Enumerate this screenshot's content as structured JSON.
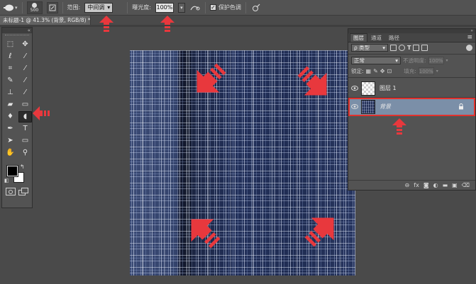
{
  "options_bar": {
    "tool_icon": "dodge-tool-icon",
    "brush_size": "500",
    "range_label": "范围:",
    "range_value": "中间调",
    "exposure_label": "曝光度:",
    "exposure_value": "100%",
    "airbrush_icon": "airbrush-icon",
    "protect_tones_label": "保护色调",
    "protect_tones_checked": true,
    "pressure_icon": "pressure-size-icon"
  },
  "document_tab": {
    "title": "未标题-1 @ 41.3% (背景, RGB/8) *",
    "close": "×"
  },
  "tools_panel": {
    "collapse": "«",
    "tools": [
      {
        "id": "rect-marquee",
        "icon": "rect-marquee-icon",
        "glyph": "⬚",
        "active": false
      },
      {
        "id": "move",
        "icon": "move-icon",
        "glyph": "✥",
        "active": false
      },
      {
        "id": "lasso",
        "icon": "lasso-icon",
        "glyph": "ℓ",
        "active": false
      },
      {
        "id": "magic-wand",
        "icon": "magic-wand-icon",
        "glyph": "⁄",
        "active": false
      },
      {
        "id": "crop",
        "icon": "crop-icon",
        "glyph": "⌗",
        "active": false
      },
      {
        "id": "eyedropper",
        "icon": "eyedropper-icon",
        "glyph": "⁄",
        "active": false
      },
      {
        "id": "healing-brush",
        "icon": "healing-brush-icon",
        "glyph": "✎",
        "active": false
      },
      {
        "id": "brush",
        "icon": "brush-icon",
        "glyph": "⁄",
        "active": false
      },
      {
        "id": "clone-stamp",
        "icon": "clone-stamp-icon",
        "glyph": "⊥",
        "active": false
      },
      {
        "id": "history-brush",
        "icon": "history-brush-icon",
        "glyph": "⁄",
        "active": false
      },
      {
        "id": "eraser",
        "icon": "eraser-icon",
        "glyph": "▰",
        "active": false
      },
      {
        "id": "gradient",
        "icon": "gradient-icon",
        "glyph": "▭",
        "active": false
      },
      {
        "id": "blur",
        "icon": "blur-icon",
        "glyph": "♦",
        "active": false
      },
      {
        "id": "dodge",
        "icon": "dodge-icon",
        "glyph": "◖",
        "active": true
      },
      {
        "id": "pen",
        "icon": "pen-icon",
        "glyph": "✒",
        "active": false
      },
      {
        "id": "type",
        "icon": "type-icon",
        "glyph": "T",
        "active": false
      },
      {
        "id": "path-select",
        "icon": "path-select-icon",
        "glyph": "➤",
        "active": false
      },
      {
        "id": "shape",
        "icon": "shape-icon",
        "glyph": "▭",
        "active": false
      },
      {
        "id": "hand",
        "icon": "hand-icon",
        "glyph": "✋",
        "active": false
      },
      {
        "id": "zoom",
        "icon": "zoom-icon",
        "glyph": "⚲",
        "active": false
      }
    ],
    "foreground_color": "#000000",
    "background_color": "#ffffff",
    "swap_glyph": "↰",
    "reset_glyph": "◧"
  },
  "layers_panel": {
    "collapse": "»",
    "tabs": [
      {
        "label": "图层",
        "active": true
      },
      {
        "label": "通道",
        "active": false
      },
      {
        "label": "路径",
        "active": false
      }
    ],
    "menu": "≡",
    "filter_value": "ρ 类型",
    "blend_mode": "正常",
    "opacity_label": "不透明度:",
    "opacity_value": "100%",
    "lock_label": "锁定:",
    "fill_label": "填充:",
    "fill_value": "100%",
    "layers": [
      {
        "name": "图层 1",
        "selected": false,
        "locked": false,
        "thumb": "checker",
        "italic": false
      },
      {
        "name": "背景",
        "selected": true,
        "locked": true,
        "thumb": "denim",
        "italic": true
      }
    ],
    "footer_icons": [
      {
        "name": "link-layers-icon",
        "glyph": "⊖"
      },
      {
        "name": "fx-icon",
        "glyph": "fx"
      },
      {
        "name": "add-mask-icon",
        "glyph": "◙"
      },
      {
        "name": "adjustment-layer-icon",
        "glyph": "◐"
      },
      {
        "name": "new-group-icon",
        "glyph": "▬"
      },
      {
        "name": "new-layer-icon",
        "glyph": "▣"
      },
      {
        "name": "delete-layer-icon",
        "glyph": "⌫"
      }
    ]
  },
  "colors": {
    "workspace": "#4a4a4a",
    "panel": "#535353",
    "annotation_red": "#e8383d",
    "selected_layer": "#7b8fa8"
  }
}
